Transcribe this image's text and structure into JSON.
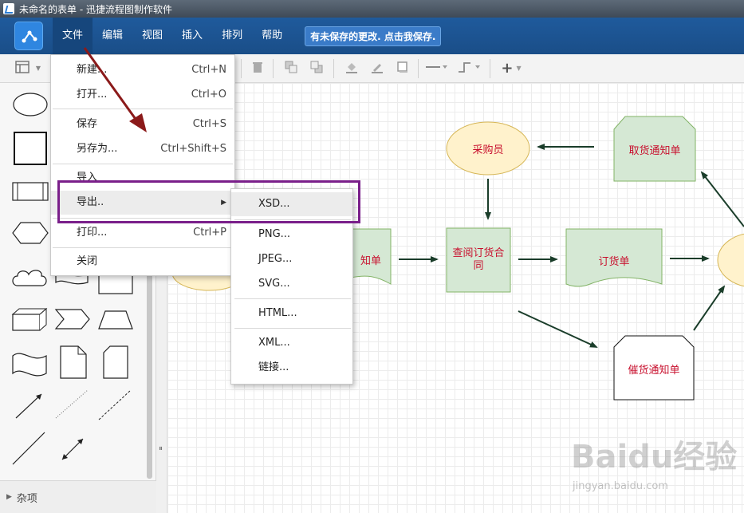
{
  "window": {
    "title": "未命名的表单 - 迅捷流程图制作软件"
  },
  "menubar": {
    "items": [
      "文件",
      "编辑",
      "视图",
      "插入",
      "排列",
      "帮助"
    ],
    "unsaved_notice": "有未保存的更改. 点击我保存."
  },
  "file_menu": {
    "items": [
      {
        "label": "新建...",
        "shortcut": "Ctrl+N"
      },
      {
        "label": "打开...",
        "shortcut": "Ctrl+O"
      },
      {
        "label": "保存",
        "shortcut": "Ctrl+S"
      },
      {
        "label": "另存为...",
        "shortcut": "Ctrl+Shift+S"
      },
      {
        "label": "导入",
        "shortcut": ""
      },
      {
        "label": "导出..",
        "shortcut": ""
      },
      {
        "label": "打印...",
        "shortcut": "Ctrl+P"
      },
      {
        "label": "关闭",
        "shortcut": ""
      }
    ]
  },
  "export_menu": {
    "items": [
      "XSD...",
      "PNG...",
      "JPEG...",
      "SVG...",
      "HTML...",
      "XML...",
      "链接..."
    ]
  },
  "left_panel": {
    "section_label": "杂项"
  },
  "diagram": {
    "nodes": {
      "purchaser": "采购员",
      "pickup_notice": "取货通知单",
      "review_contract": "查阅订货合同",
      "order": "订货单",
      "partial_left": "知单",
      "reminder_notice": "催货通知单"
    }
  },
  "colors": {
    "menubar_bg": "#1f5a9c",
    "node_green": "#d5e8d4",
    "node_yellow": "#fff2cc",
    "node_text": "#c8102e",
    "edge": "#1a3d2a",
    "highlight": "#7a1f8a",
    "annotation_arrow": "#8b1a1a"
  },
  "watermark": {
    "main": "Baidu经验",
    "sub": "jingyan.baidu.com"
  }
}
